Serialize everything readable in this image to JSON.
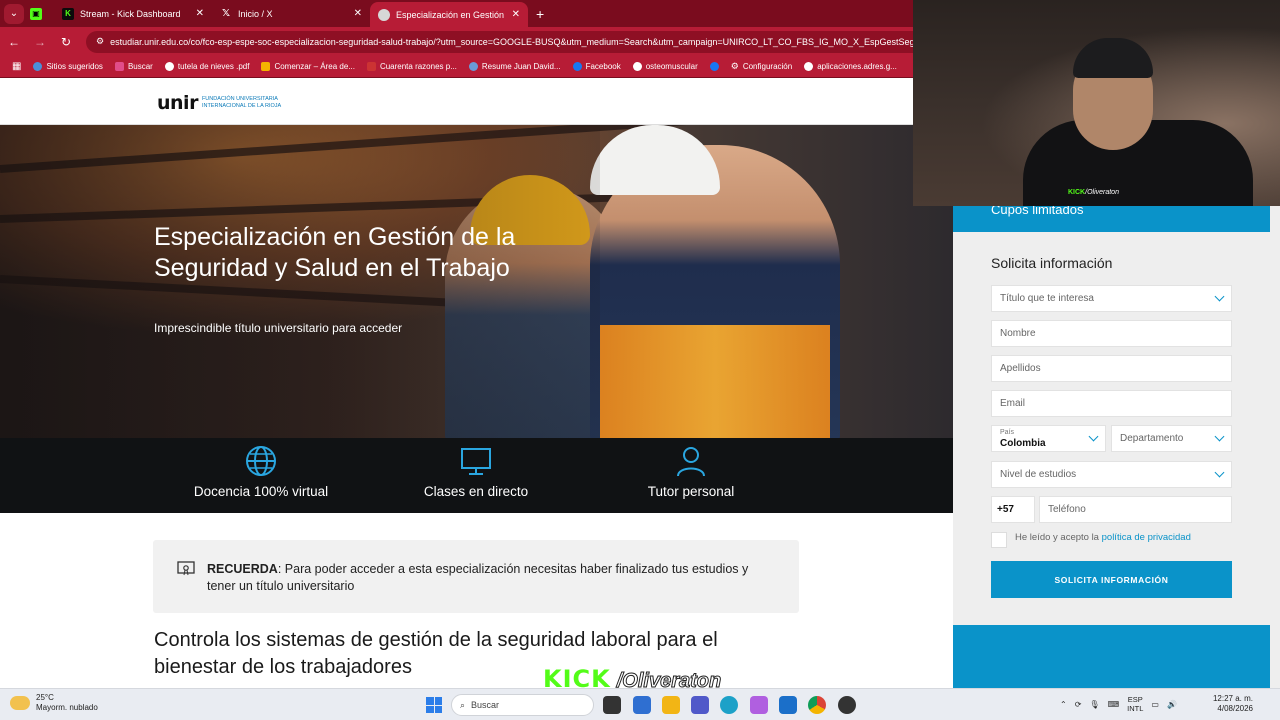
{
  "browser": {
    "tabs": [
      {
        "title": "",
        "color": "#2d6a2d",
        "icon": "kick-icon"
      },
      {
        "title": "Stream - Kick Dashboard",
        "color": "#53fc18",
        "icon": "kick-icon"
      },
      {
        "title": "Inicio / X",
        "color": "#000000",
        "icon": "x-icon"
      },
      {
        "title": "Especialización en Gestión de l...",
        "color": "#888888",
        "icon": "globe-icon"
      }
    ],
    "url": "estudiar.unir.edu.co/co/fco-esp-espe-soc-especializacion-seguridad-salud-trabajo/?utm_source=GOOGLE-BUSQ&utm_medium=Search&utm_campaign=UNIRCO_LT_CO_FBS_IG_MO_X_EspGestSeg",
    "bookmarks": [
      "Sitios sugeridos",
      "Buscar",
      "tutela de nieves .pdf",
      "Comenzar – Área de...",
      "Cuarenta razones p...",
      "Resume Juan David...",
      "Facebook",
      "osteomuscular",
      "Configuración",
      "aplicaciones.adres.g..."
    ]
  },
  "site": {
    "logo_word": "unir",
    "logo_sub": "FUNDACIÓN UNIVERSITARIA INTERNACIONAL DE LA RIOJA",
    "hero_title": "Especialización en Gestión de la Seguridad y Salud en el Trabajo",
    "hero_subtitle": "Imprescindible título universitario para acceder",
    "features": [
      {
        "label": "Docencia 100% virtual",
        "icon": "globe-icon"
      },
      {
        "label": "Clases en directo",
        "icon": "monitor-icon"
      },
      {
        "label": "Tutor personal",
        "icon": "user-icon"
      }
    ],
    "remember_label": "RECUERDA",
    "remember_text": ": Para poder acceder a esta especialización necesitas haber finalizado tus estudios y tener un título universitario",
    "section_title": "Controla los sistemas de gestión de la seguridad laboral para el bienestar de los trabajadores"
  },
  "form": {
    "cupos": "Cupos limitados",
    "title": "Solicita información",
    "titulo_placeholder": "Título que te interesa",
    "nombre_placeholder": "Nombre",
    "apellidos_placeholder": "Apellidos",
    "email_placeholder": "Email",
    "pais_label": "País",
    "pais_value": "Colombia",
    "departamento_placeholder": "Departamento",
    "nivel_placeholder": "Nivel de estudios",
    "prefix": "+57",
    "telefono_placeholder": "Teléfono",
    "consent_text": "He leído y acepto la",
    "consent_link": "política de privacidad",
    "submit_label": "SOLICITA INFORMACIÓN",
    "accent": "#0a93c9"
  },
  "stream": {
    "cam_tag_kick": "KICK",
    "cam_tag_user": "/Oliveraton",
    "overlay_kick": "KICK",
    "overlay_user": "/Oliveraton"
  },
  "taskbar": {
    "temp": "25°C",
    "weather": "Mayorm. nublado",
    "search": "Buscar",
    "lang1": "ESP",
    "lang2": "INTL",
    "time": "12:27 a. m.",
    "date": "4/08/2026"
  }
}
